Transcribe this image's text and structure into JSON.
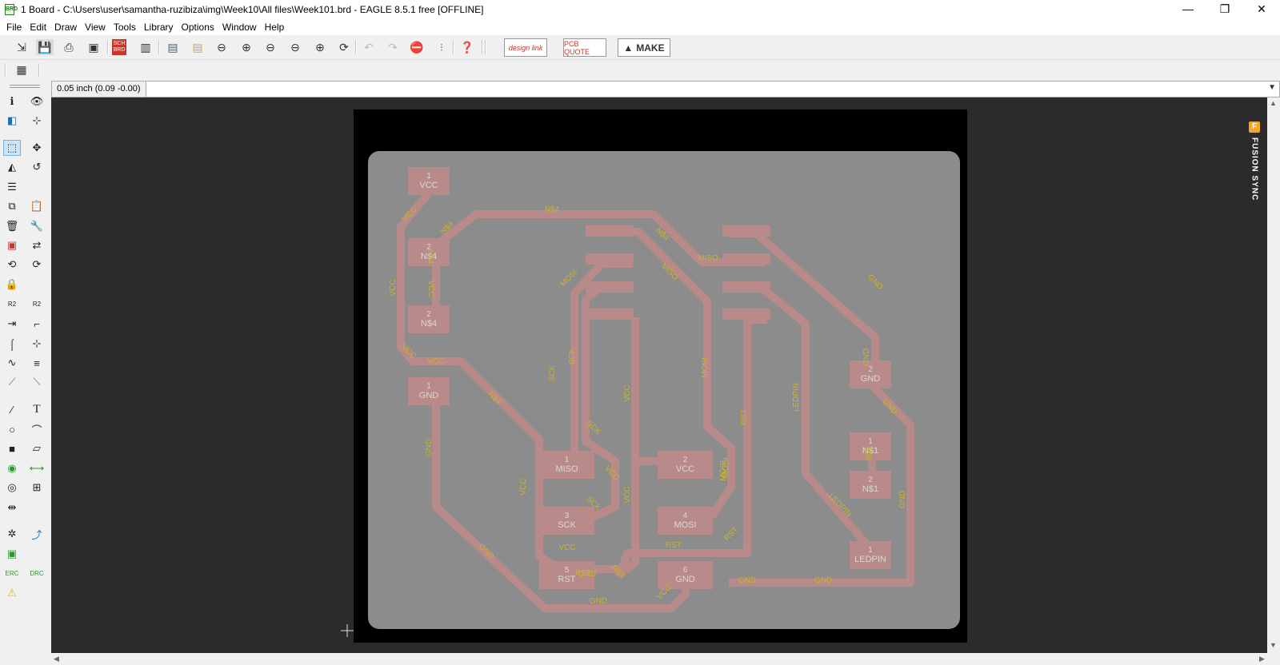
{
  "window": {
    "title": "1 Board - C:\\Users\\user\\samantha-ruzibiza\\img\\Week10\\All files\\Week101.brd - EAGLE 8.5.1 free [OFFLINE]",
    "app_icon_text": "BRD",
    "minimize": "—",
    "restore": "❐",
    "close": "✕"
  },
  "menu": [
    "File",
    "Edit",
    "Draw",
    "View",
    "Tools",
    "Library",
    "Options",
    "Window",
    "Help"
  ],
  "toolbar": {
    "sch_brd": "SCH BRD",
    "design_link": "design link",
    "pcb_quote": "PCB QUOTE",
    "make": "MAKE"
  },
  "command": {
    "coordinates": "0.05 inch (0.09 -0.00)",
    "value": ""
  },
  "side_panel": {
    "fusion_sync": "FUSION SYNC",
    "fusion_icon": "F"
  },
  "colors": {
    "board": "#8c8c8c",
    "pad": "#b88a8a",
    "trace": "#b88a8a",
    "silk_text": "#c9b233",
    "pad_text": "#d8d8d8",
    "background": "#2b2b2b",
    "board_area": "#000000"
  },
  "pads": [
    {
      "num": "1",
      "name": "VCC"
    },
    {
      "num": "2",
      "name": "N$4"
    },
    {
      "num": "2",
      "name": "N$4"
    },
    {
      "num": "1",
      "name": "GND"
    },
    {
      "num": "1",
      "name": "MISO"
    },
    {
      "num": "3",
      "name": "SCK"
    },
    {
      "num": "5",
      "name": "RST"
    },
    {
      "num": "2",
      "name": "VCC"
    },
    {
      "num": "4",
      "name": "MOSI"
    },
    {
      "num": "6",
      "name": "GND"
    },
    {
      "num": "2",
      "name": "GND"
    },
    {
      "num": "1",
      "name": "N$1"
    },
    {
      "num": "2",
      "name": "N$1"
    },
    {
      "num": "1",
      "name": "LEDPIN"
    }
  ],
  "net_labels": [
    "VCC",
    "N$4",
    "N$4",
    "N$4",
    "VCC",
    "VCC",
    "VCC",
    "VCC",
    "N$4",
    "N$4",
    "MISO",
    "MOSI",
    "MISO",
    "SCK",
    "SCK",
    "SCK",
    "VCC",
    "MOSI",
    "MOSI",
    "GND",
    "GND",
    "LEDPIN",
    "RST",
    "GND",
    "N$1",
    "GND",
    "LEDPIN",
    "GND",
    "SCK",
    "VCC",
    "VCC",
    "VCC",
    "RST",
    "RST",
    "RST",
    "RST",
    "GND",
    "GND",
    "GND",
    "GND",
    "GND",
    "VCC",
    "VCC",
    "MOSI"
  ]
}
